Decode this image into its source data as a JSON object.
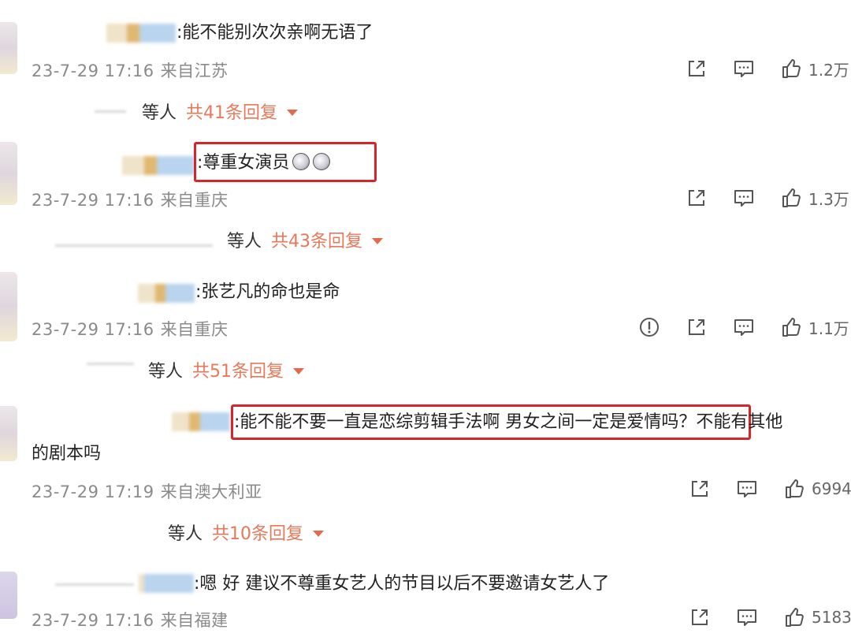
{
  "comments": [
    {
      "text": ":能不能别次次亲啊无语了",
      "date": "23-7-29 17:16",
      "location": "来自江苏",
      "likes": "1.2万",
      "replies_who": "等人",
      "replies_count": "共41条回复",
      "has_report": false
    },
    {
      "text": ":尊重女演员",
      "date": "23-7-29 17:16",
      "location": "来自重庆",
      "likes": "1.3万",
      "replies_who": "等人",
      "replies_count": "共43条回复",
      "has_report": false
    },
    {
      "text": ":张艺凡的命也是命",
      "date": "23-7-29 17:16",
      "location": "来自重庆",
      "likes": "1.1万",
      "replies_who": "等人",
      "replies_count": "共51条回复",
      "has_report": true
    },
    {
      "text": ":能不能不要一直是恋综剪辑手法啊 男女之间一定是爱情吗？不能有其他",
      "text_line2": "的剧本吗",
      "date": "23-7-29 17:19",
      "location": "来自澳大利亚",
      "likes": "6994",
      "replies_who": "等人",
      "replies_count": "共10条回复",
      "has_report": false
    },
    {
      "text": ":嗯 好 建议不尊重女艺人的节目以后不要邀请女艺人了",
      "date": "23-7-29 17:16",
      "location": "来自福建",
      "likes": "5183",
      "has_report": false
    }
  ],
  "colors": {
    "highlight_box": "#d7262b",
    "reply_count": "#e8785a",
    "meta_gray": "#8a8a8a"
  },
  "icons": {
    "report": "report-icon",
    "share": "share-icon",
    "comment": "comment-icon",
    "like": "thumbs-up-icon",
    "expand": "caret-down-icon"
  }
}
